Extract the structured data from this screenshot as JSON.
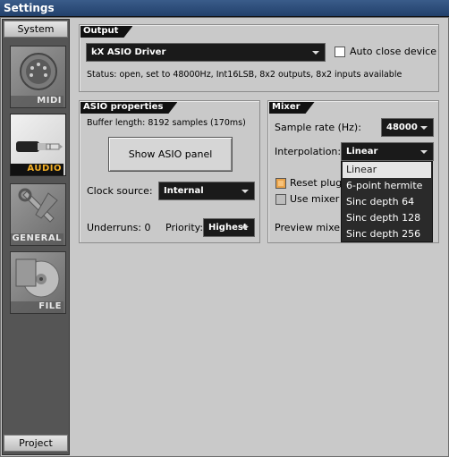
{
  "window": {
    "title": "Settings"
  },
  "sidebar": {
    "top_button": "System",
    "bottom_button": "Project",
    "items": [
      {
        "label": "MIDI",
        "icon": "midi-connector-icon",
        "active": false
      },
      {
        "label": "AUDIO",
        "icon": "audio-jack-icon",
        "active": true
      },
      {
        "label": "GENERAL",
        "icon": "wrench-icon",
        "active": false
      },
      {
        "label": "FILE",
        "icon": "disc-icon",
        "active": false
      }
    ]
  },
  "output": {
    "tab": "Output",
    "driver": "kX ASIO Driver",
    "auto_close_label": "Auto close device",
    "auto_close_checked": false,
    "status": "Status: open, set to 48000Hz, Int16LSB, 8x2 outputs, 8x2 inputs available"
  },
  "asio": {
    "tab": "ASIO properties",
    "buffer": "Buffer length: 8192 samples (170ms)",
    "show_panel_button": "Show ASIO panel",
    "clock_label": "Clock source:",
    "clock_value": "Internal",
    "underruns": "Underruns: 0",
    "priority_label": "Priority:",
    "priority_value": "Highest"
  },
  "mixer": {
    "tab": "Mixer",
    "sample_rate_label": "Sample rate (Hz):",
    "sample_rate_value": "48000",
    "interpolation_label": "Interpolation:",
    "interpolation_value": "Linear",
    "reset_plugins_label": "Reset plugins",
    "reset_plugins_checked": true,
    "use_mixer_label": "Use mixer as",
    "use_mixer_checked": false,
    "preview_label": "Preview mixer b",
    "interpolation_options": [
      "Linear",
      "6-point hermite",
      "Sinc depth 64",
      "Sinc depth 128",
      "Sinc depth 256"
    ],
    "selected_option": "Linear"
  },
  "colors": {
    "accent": "#f4b026",
    "panel_bg": "#c9c9c9",
    "dark": "#1a1a1a"
  }
}
